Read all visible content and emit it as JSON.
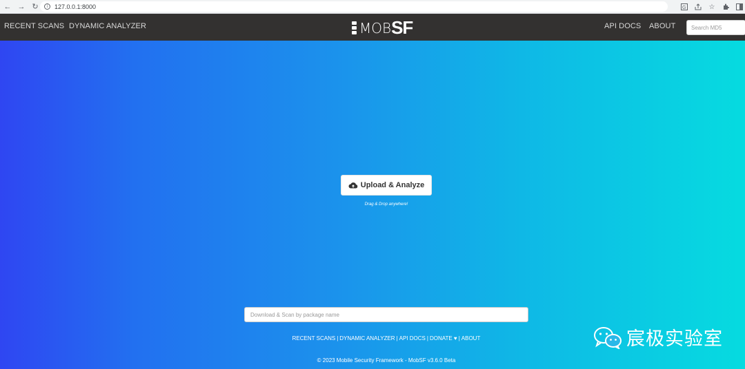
{
  "browser": {
    "url": "127.0.0.1:8000",
    "nav_icons": [
      "back-icon",
      "forward-icon",
      "reload-icon"
    ],
    "right_icons": [
      "translate-icon",
      "share-icon",
      "star-icon",
      "extensions-icon",
      "sidepanel-icon"
    ]
  },
  "navbar": {
    "left_links": [
      "RECENT SCANS",
      "DYNAMIC ANALYZER"
    ],
    "brand_mob": "MOB",
    "brand_sf": "SF",
    "right_links": [
      "API DOCS",
      "ABOUT"
    ],
    "search_placeholder": "Search MD5"
  },
  "main": {
    "upload_label": "Upload & Analyze",
    "drag_text": "Drag & Drop anywhere!",
    "package_placeholder": "Download & Scan by package name"
  },
  "footer": {
    "links": [
      "RECENT SCANS",
      "DYNAMIC ANALYZER",
      "API DOCS",
      "DONATE ♥",
      "ABOUT"
    ],
    "copyright": "© 2023 Mobile Security Framework - MobSF v3.6.0 Beta"
  },
  "watermark": {
    "text": "宸极实验室"
  },
  "colors": {
    "navbar_bg": "#333130",
    "gradient_left": "#2f46f2",
    "gradient_right": "#06dbe0"
  }
}
